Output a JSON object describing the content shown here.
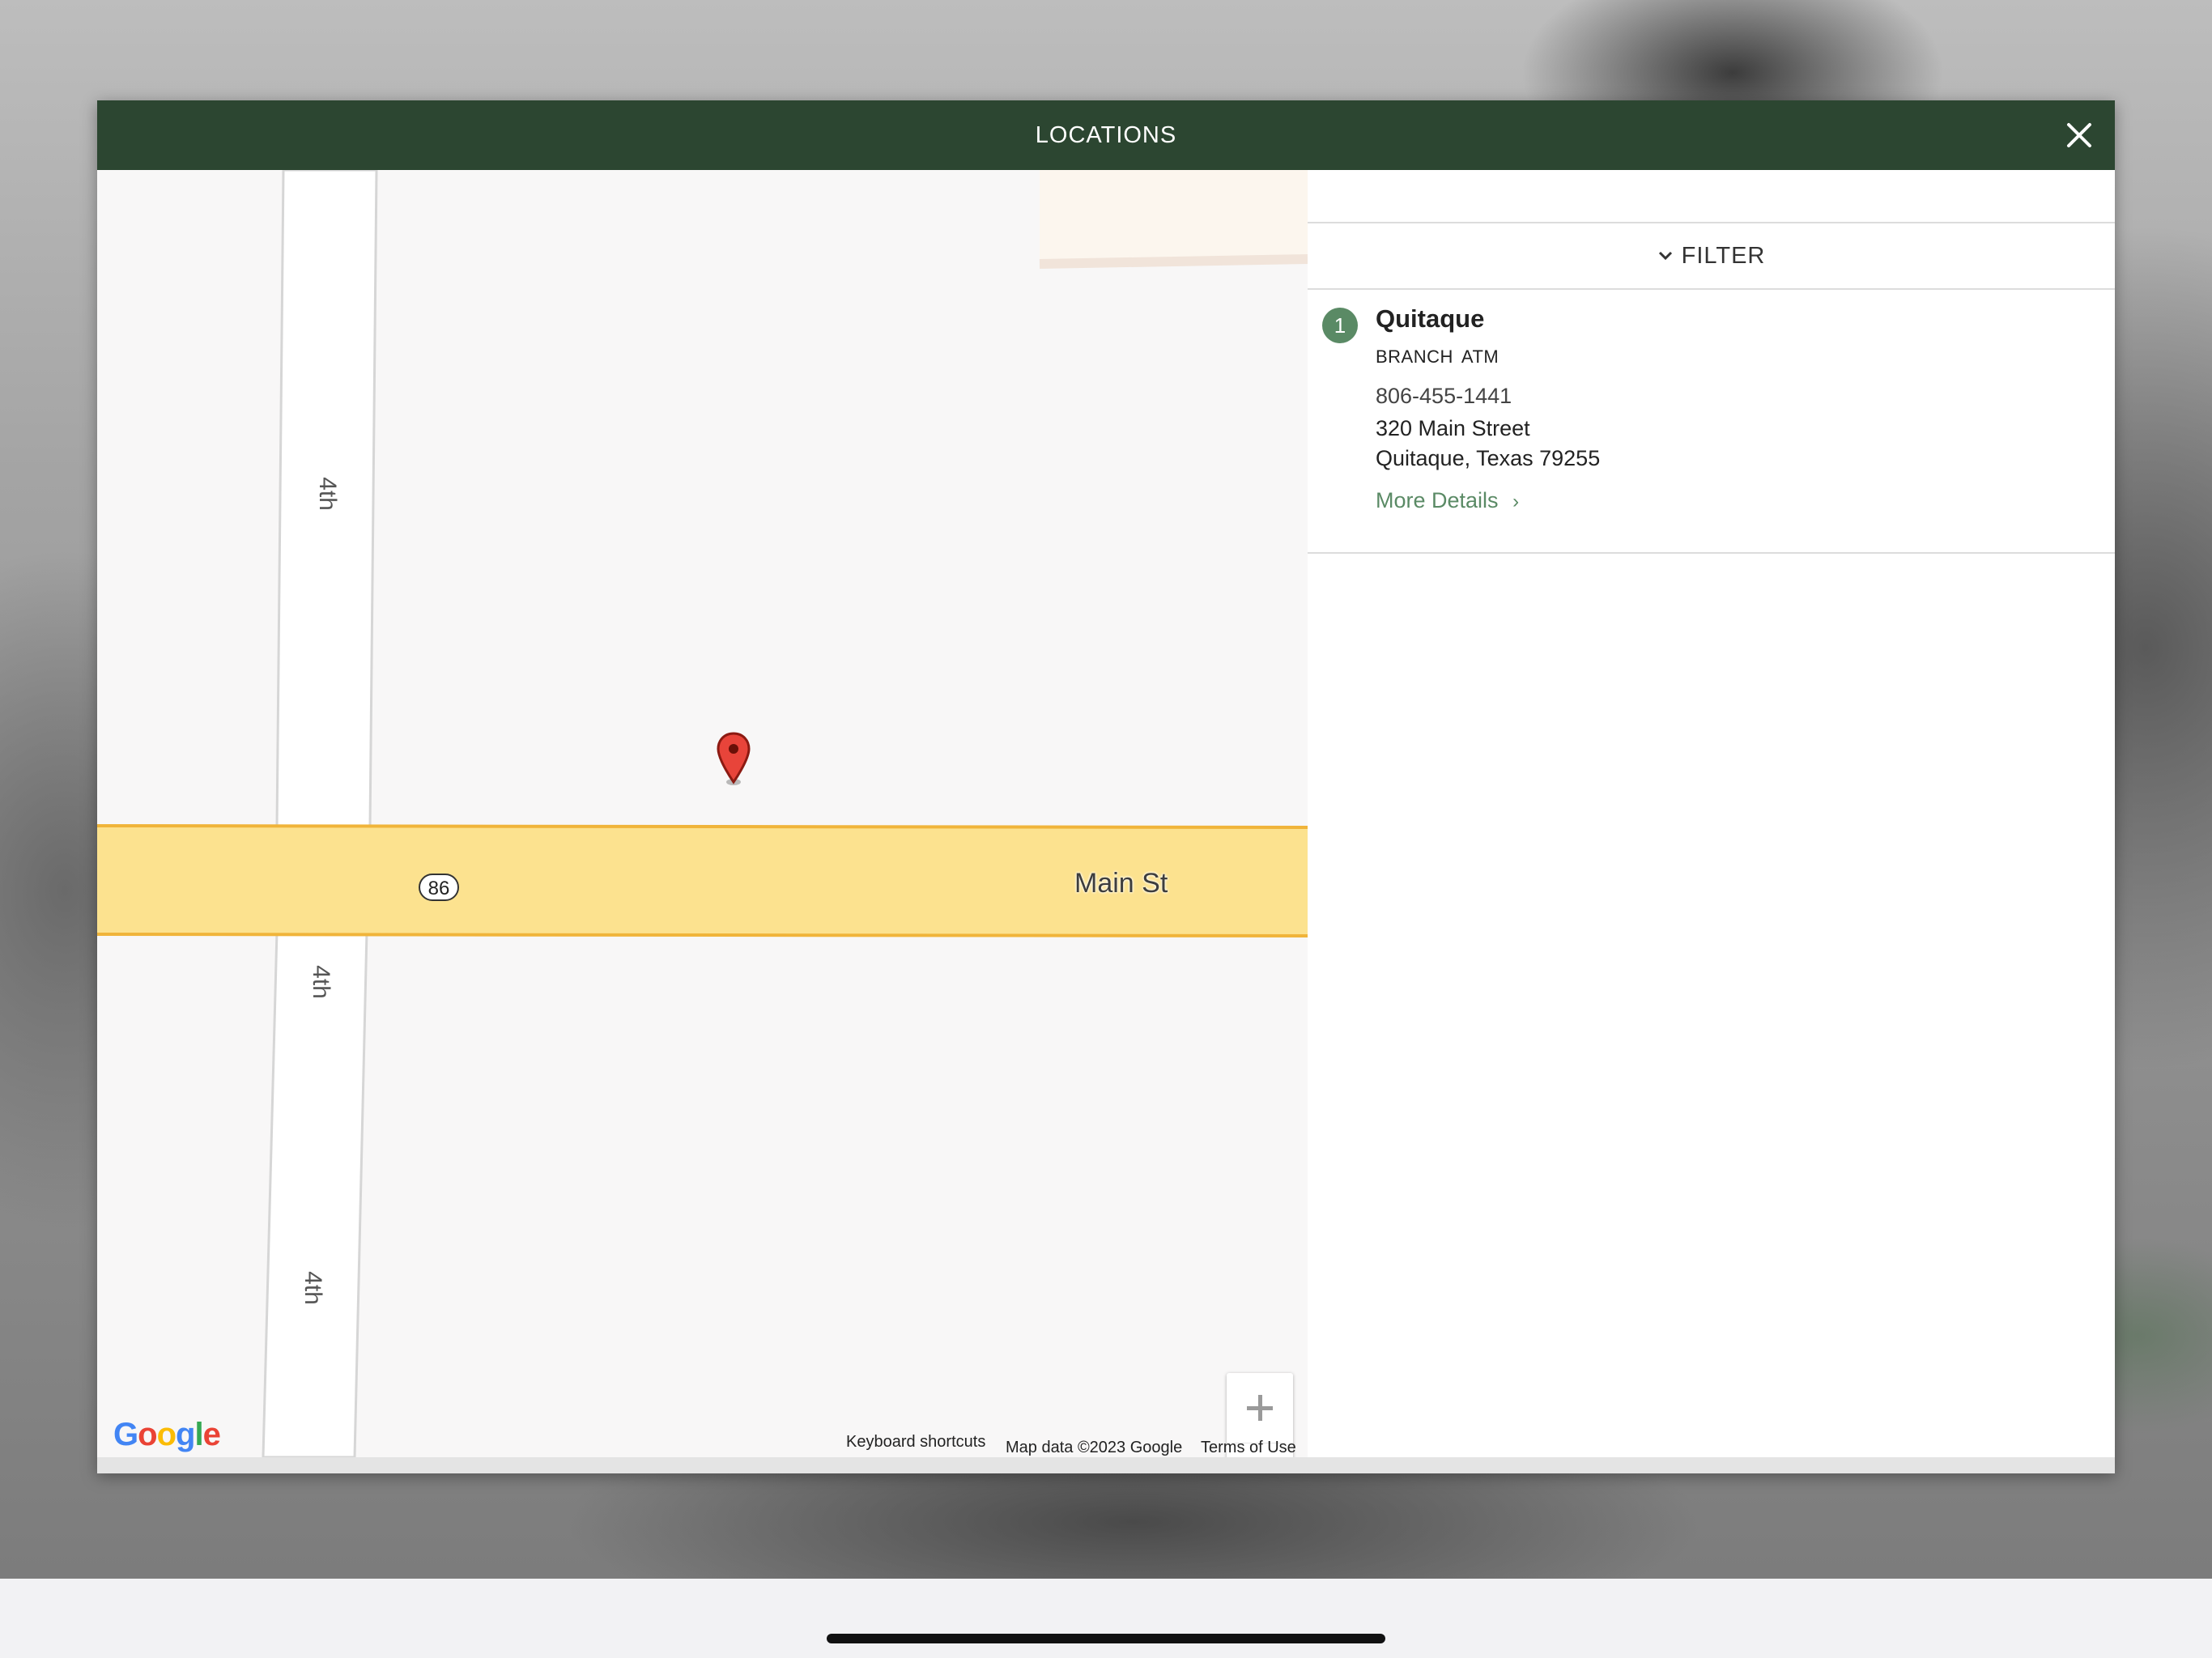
{
  "modal": {
    "title": "LOCATIONS",
    "close_icon": "close-icon"
  },
  "map": {
    "streets": {
      "main": "Main St",
      "cross_top": "4th",
      "cross_mid": "4th",
      "cross_bottom": "4th"
    },
    "route_number": "86",
    "google_logo": "Google",
    "footer": {
      "keyboard_shortcuts": "Keyboard shortcuts",
      "map_data": "Map data ©2023 Google",
      "terms": "Terms of Use"
    },
    "zoom": {
      "in_icon": "plus-icon",
      "out_icon": "minus-icon"
    },
    "colors": {
      "main_road": "#fce28f",
      "main_road_edge": "#f0b43a",
      "pin": "#e8443a"
    }
  },
  "panel": {
    "filter_label": "FILTER",
    "filter_icon": "chevron-down-icon",
    "locations": [
      {
        "number": "1",
        "name": "Quitaque",
        "tags": [
          "BRANCH",
          "ATM"
        ],
        "phone": "806-455-1441",
        "address_line1": "320 Main Street",
        "address_line2": "Quitaque, Texas 79255",
        "more_details": "More Details"
      }
    ]
  },
  "colors": {
    "header_bg": "#2c4631",
    "accent_green": "#5a8a65"
  }
}
